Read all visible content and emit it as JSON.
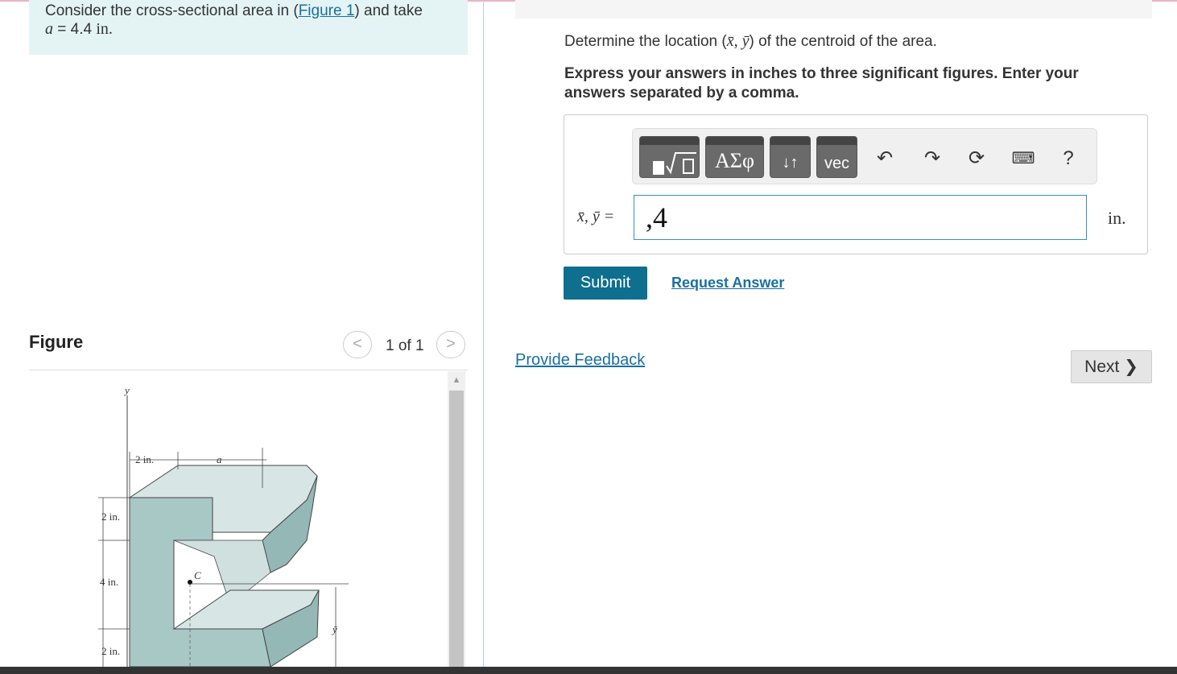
{
  "problem": {
    "text_prefix": "Consider the cross-sectional area in (",
    "figure_link": "Figure 1",
    "text_suffix": ") and take",
    "var": "a",
    "value": " = 4.4 ",
    "unit": "in."
  },
  "figure": {
    "title": "Figure",
    "counter": "1 of 1",
    "prev_label": "<",
    "next_label": ">",
    "labels": {
      "y_axis": "y",
      "dim_2in_top": "2 in.",
      "dim_a": "a",
      "dim_2in_left": "2 in.",
      "dim_4in": "4 in.",
      "dim_2in_bottom": "2 in.",
      "centroid": "C",
      "ybar": "ȳ"
    }
  },
  "question": {
    "text_prefix": "Determine the location (",
    "vars": "x̄, ȳ",
    "text_suffix": ") of the centroid of the area."
  },
  "instructions": "Express your answers in inches to three significant figures. Enter your answers separated by a comma.",
  "toolbar": {
    "greek_label": "ΑΣφ",
    "arrows_label": "↓↑",
    "vec_label": "vec",
    "undo_icon": "undo-icon",
    "redo_icon": "redo-icon",
    "reset_icon": "reset-icon",
    "keyboard_icon": "keyboard-icon",
    "help_label": "?"
  },
  "answer": {
    "label": "x̄, ȳ =",
    "value": ",4",
    "unit": "in."
  },
  "actions": {
    "submit": "Submit",
    "request": "Request Answer",
    "feedback": "Provide Feedback",
    "next": "Next"
  },
  "colors": {
    "accent": "#0e6f8f",
    "link": "#1a6fa0",
    "problem_bg": "#e4f4f4",
    "figure_fill": "#a8c8c6"
  }
}
